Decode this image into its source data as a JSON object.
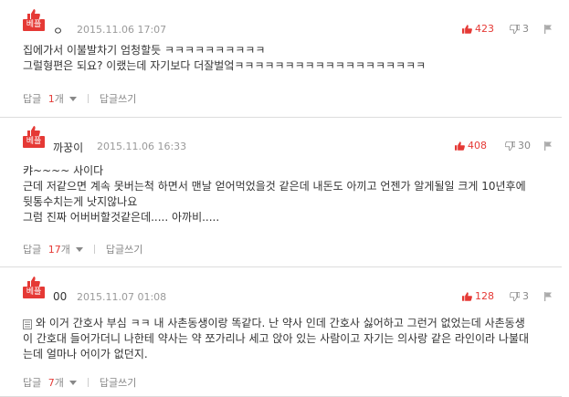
{
  "labels": {
    "best": "베플",
    "reply": "답글",
    "reply_unit": "개",
    "write_reply": "답글쓰기"
  },
  "comments": [
    {
      "author": "ㅇ",
      "time": "2015.11.06 17:07",
      "likes": "423",
      "dislikes": "3",
      "text": "집에가서 이불발차기 엄청할듯 ㅋㅋㅋㅋㅋㅋㅋㅋㅋㅋ\n그럴형편은 되요? 이랬는데 자기보다 더잘벌엌ㅋㅋㅋㅋㅋㅋㅋㅋㅋㅋㅋㅋㅋㅋㅋㅋㅋㅋㅋ",
      "reply_count": "1"
    },
    {
      "author": "까꿍이",
      "time": "2015.11.06 16:33",
      "likes": "408",
      "dislikes": "30",
      "text": "캬~~~~ 사이다\n근데 저같으면 계속 못버는척 하면서 맨날 얻어먹었을것 같은데 내돈도 아끼고 언젠가 알게될일 크게 10년후에 뒷통수치는게 낫지않나요\n그럼 진짜 어버버할것같은데..... 아까비.....",
      "reply_count": "17"
    },
    {
      "author": "00",
      "time": "2015.11.07 01:08",
      "likes": "128",
      "dislikes": "3",
      "text": "와 이거 간호사 부심 ㅋㅋ 내 사촌동생이랑 똑같다. 난 약사 인데 간호사 싫어하고 그런거 없었는데 사촌동생이 간호대 들어가더니 나한테 약사는 약 쪼가리나 세고 앉아 있는 사람이고 자기는 의사랑 같은 라인이라 나불대는데 얼마나 어이가 없던지.",
      "reply_count": "7"
    }
  ]
}
